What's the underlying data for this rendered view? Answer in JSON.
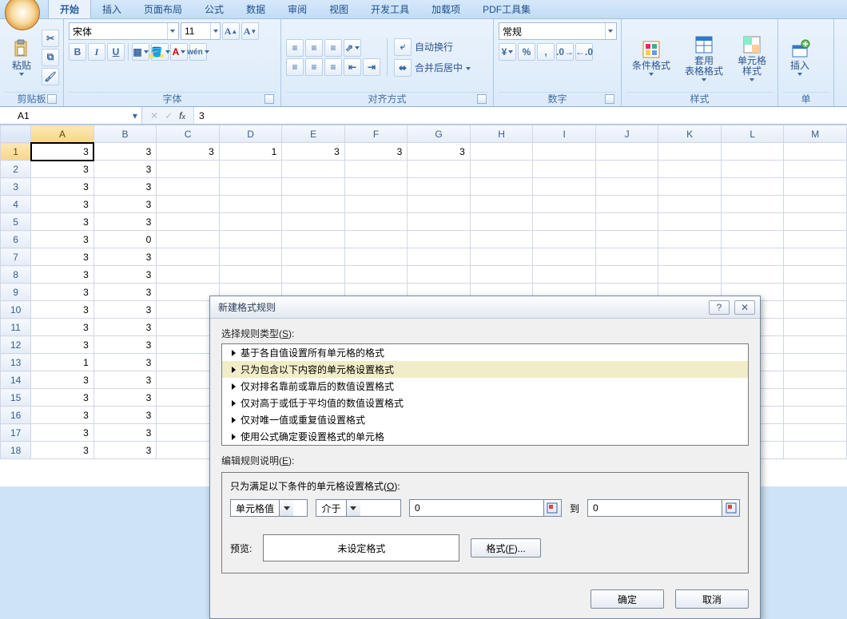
{
  "tabs": {
    "items": [
      "开始",
      "插入",
      "页面布局",
      "公式",
      "数据",
      "审阅",
      "视图",
      "开发工具",
      "加载项",
      "PDF工具集"
    ],
    "active": 0
  },
  "ribbon": {
    "clipboard": {
      "paste": "粘贴",
      "label": "剪贴板"
    },
    "font": {
      "name": "宋体",
      "size": "11",
      "label": "字体"
    },
    "align": {
      "wrap": "自动换行",
      "merge": "合并后居中",
      "label": "对齐方式"
    },
    "number": {
      "format": "常规",
      "label": "数字"
    },
    "styles": {
      "cond": "条件格式",
      "table": "套用\n表格格式",
      "cell": "单元格\n样式",
      "label": "样式"
    },
    "cells": {
      "insert": "插入",
      "label": "单"
    }
  },
  "formula": {
    "cell": "A1",
    "value": "3"
  },
  "columns": [
    "A",
    "B",
    "C",
    "D",
    "E",
    "F",
    "G",
    "H",
    "I",
    "J",
    "K",
    "L",
    "M"
  ],
  "rows": [
    {
      "n": 1,
      "c": [
        "3",
        "3",
        "3",
        "1",
        "3",
        "3",
        "3",
        "",
        "",
        "",
        "",
        "",
        ""
      ]
    },
    {
      "n": 2,
      "c": [
        "3",
        "3",
        "",
        "",
        "",
        "",
        "",
        "",
        "",
        "",
        "",
        "",
        ""
      ]
    },
    {
      "n": 3,
      "c": [
        "3",
        "3",
        "",
        "",
        "",
        "",
        "",
        "",
        "",
        "",
        "",
        "",
        ""
      ]
    },
    {
      "n": 4,
      "c": [
        "3",
        "3",
        "",
        "",
        "",
        "",
        "",
        "",
        "",
        "",
        "",
        "",
        ""
      ]
    },
    {
      "n": 5,
      "c": [
        "3",
        "3",
        "",
        "",
        "",
        "",
        "",
        "",
        "",
        "",
        "",
        "",
        ""
      ]
    },
    {
      "n": 6,
      "c": [
        "3",
        "0",
        "",
        "",
        "",
        "",
        "",
        "",
        "",
        "",
        "",
        "",
        ""
      ]
    },
    {
      "n": 7,
      "c": [
        "3",
        "3",
        "",
        "",
        "",
        "",
        "",
        "",
        "",
        "",
        "",
        "",
        ""
      ]
    },
    {
      "n": 8,
      "c": [
        "3",
        "3",
        "",
        "",
        "",
        "",
        "",
        "",
        "",
        "",
        "",
        "",
        ""
      ]
    },
    {
      "n": 9,
      "c": [
        "3",
        "3",
        "",
        "",
        "",
        "",
        "",
        "",
        "",
        "",
        "",
        "",
        ""
      ]
    },
    {
      "n": 10,
      "c": [
        "3",
        "3",
        "",
        "",
        "",
        "",
        "",
        "",
        "",
        "",
        "",
        "",
        ""
      ]
    },
    {
      "n": 11,
      "c": [
        "3",
        "3",
        "",
        "",
        "",
        "",
        "",
        "",
        "",
        "",
        "",
        "",
        ""
      ]
    },
    {
      "n": 12,
      "c": [
        "3",
        "3",
        "",
        "",
        "",
        "",
        "",
        "",
        "",
        "",
        "",
        "",
        ""
      ]
    },
    {
      "n": 13,
      "c": [
        "1",
        "3",
        "",
        "",
        "",
        "",
        "",
        "",
        "",
        "",
        "",
        "",
        ""
      ]
    },
    {
      "n": 14,
      "c": [
        "3",
        "3",
        "",
        "",
        "",
        "",
        "",
        "",
        "",
        "",
        "",
        "",
        ""
      ]
    },
    {
      "n": 15,
      "c": [
        "3",
        "3",
        "",
        "",
        "",
        "",
        "",
        "",
        "",
        "",
        "",
        "",
        ""
      ]
    },
    {
      "n": 16,
      "c": [
        "3",
        "3",
        "",
        "",
        "",
        "",
        "",
        "",
        "",
        "",
        "",
        "",
        ""
      ]
    },
    {
      "n": 17,
      "c": [
        "3",
        "3",
        "",
        "",
        "",
        "",
        "",
        "",
        "",
        "",
        "",
        "",
        ""
      ]
    },
    {
      "n": 18,
      "c": [
        "3",
        "3",
        "",
        "",
        "",
        "",
        "",
        "",
        "",
        "",
        "",
        "",
        ""
      ]
    }
  ],
  "dialog": {
    "title": "新建格式规则",
    "select_label": "选择规则类型(",
    "select_key": "S",
    "select_label2": "):",
    "rules": [
      "基于各自值设置所有单元格的格式",
      "只为包含以下内容的单元格设置格式",
      "仅对排名靠前或靠后的数值设置格式",
      "仅对高于或低于平均值的数值设置格式",
      "仅对唯一值或重复值设置格式",
      "使用公式确定要设置格式的单元格"
    ],
    "rules_selected": 1,
    "edit_label": "编辑规则说明(",
    "edit_key": "E",
    "edit_label2": "):",
    "cond_label": "只为满足以下条件的单元格设置格式(",
    "cond_key": "O",
    "cond_label2": "):",
    "basis": "单元格值",
    "op": "介于",
    "from": "0",
    "to_label": "到",
    "to": "0",
    "preview_label": "预览:",
    "preview_text": "未设定格式",
    "format_btn": "格式(",
    "format_key": "F",
    "format_btn2": ")...",
    "ok": "确定",
    "cancel": "取消"
  }
}
